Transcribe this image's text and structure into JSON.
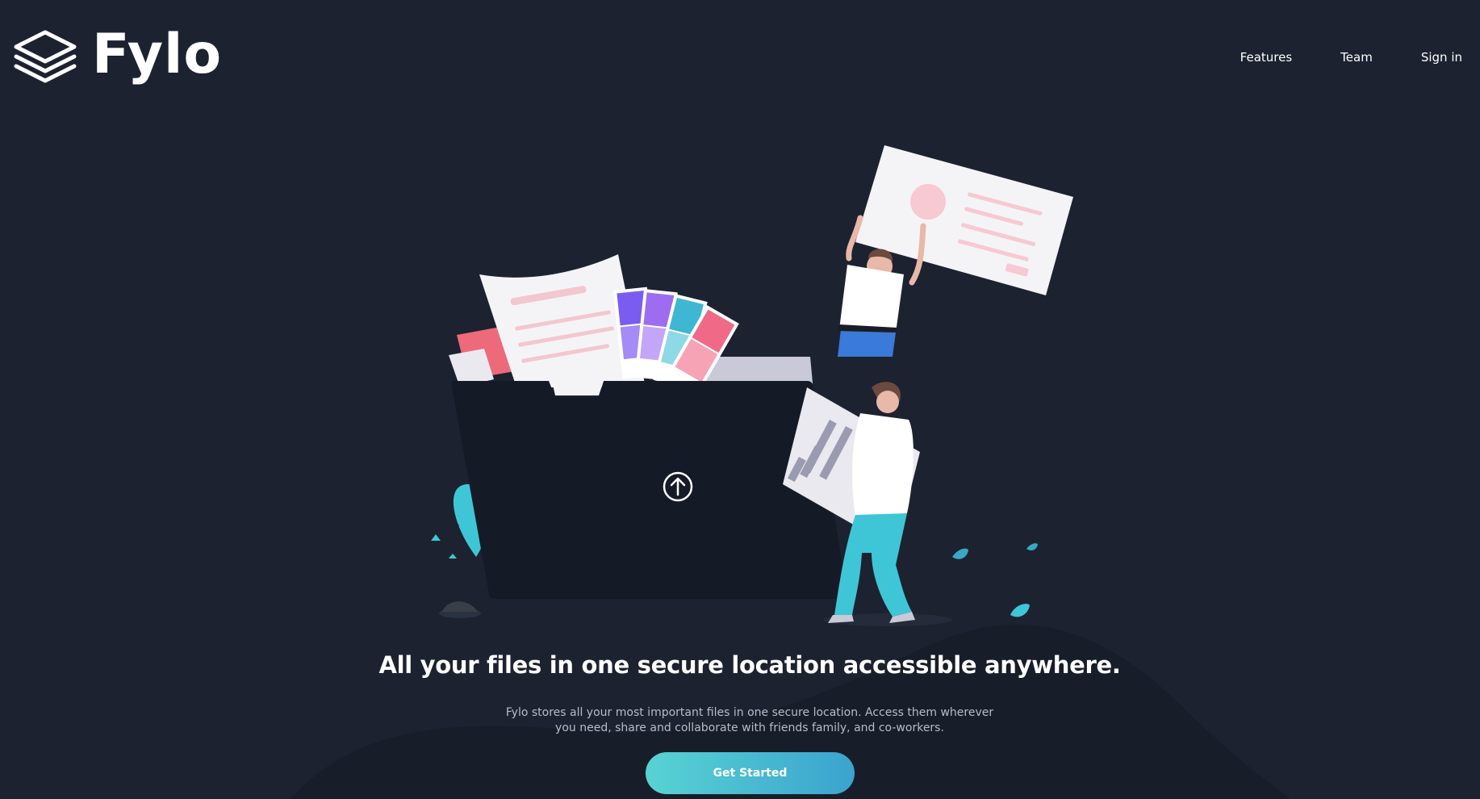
{
  "brand": {
    "name": "Fylo"
  },
  "nav": {
    "items": [
      {
        "label": "Features"
      },
      {
        "label": "Team"
      },
      {
        "label": "Sign in"
      }
    ]
  },
  "hero": {
    "headline": "All your files in one secure location accessible anywhere.",
    "description_line1": "Fylo stores all your most important files in one secure location. Access them wherever",
    "description_line2": "you need, share and collaborate with friends family, and co-workers.",
    "cta_label": "Get Started"
  },
  "colors": {
    "background": "#1c2230",
    "curve": "#181e29",
    "cta_start": "#58d3d3",
    "cta_end": "#3ba3cf"
  },
  "icons": {
    "logo": "layers-icon",
    "upload": "arrow-up-circle-icon"
  }
}
